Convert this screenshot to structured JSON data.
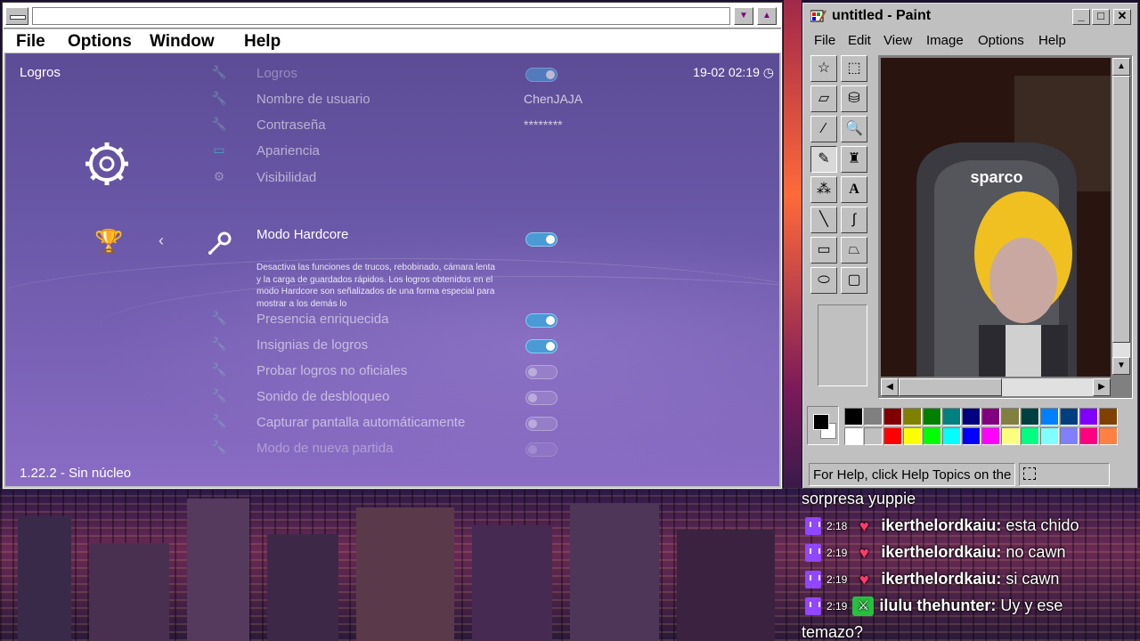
{
  "retroarch": {
    "menu": [
      "File",
      "Options",
      "Window",
      "Help"
    ],
    "header_title": "Logros",
    "clock": "19-02 02:19",
    "version": "1.22.2 - Sin núcleo",
    "rows": [
      {
        "label": "Logros",
        "value": "",
        "toggle": "on",
        "style": "dimmer"
      },
      {
        "label": "Nombre de usuario",
        "value": "ChenJAJA",
        "toggle": "",
        "style": "dim"
      },
      {
        "label": "Contraseña",
        "value": "********",
        "toggle": "",
        "style": "dim"
      },
      {
        "label": "Apariencia",
        "value": "",
        "toggle": "",
        "style": "dim"
      },
      {
        "label": "Visibilidad",
        "value": "",
        "toggle": "",
        "style": "dim"
      }
    ],
    "selected": {
      "label": "Modo Hardcore",
      "description": "Desactiva las funciones de trucos, rebobinado, cámara lenta y la carga de guardados rápidos. Los logros obtenidos en el modo Hardcore son señalizados de una forma especial para mostrar a los demás lo"
    },
    "rows_below": [
      {
        "label": "Presencia enriquecida",
        "toggle": "on"
      },
      {
        "label": "Insignias de logros",
        "toggle": "on"
      },
      {
        "label": "Probar logros no oficiales",
        "toggle": "off"
      },
      {
        "label": "Sonido de desbloqueo",
        "toggle": "off"
      },
      {
        "label": "Capturar pantalla automáticamente",
        "toggle": "off"
      },
      {
        "label": "Modo de nueva partida",
        "toggle": "off"
      }
    ],
    "icons": {
      "settings": "gear-icon",
      "achievements": "trophy-icon",
      "back": "chevron-left-icon",
      "selected": "wrench-icon"
    }
  },
  "paint": {
    "title": "untitled - Paint",
    "menu": [
      "File",
      "Edit",
      "View",
      "Image",
      "Options",
      "Help"
    ],
    "status": "For Help, click Help Topics on the",
    "canvas_text": "sparco",
    "tools": [
      "free-select",
      "select",
      "eraser",
      "fill",
      "eyedropper",
      "magnifier",
      "pencil",
      "brush",
      "airbrush",
      "text",
      "line",
      "curve",
      "rectangle",
      "polygon",
      "ellipse",
      "rounded-rectangle"
    ],
    "palette_row1": [
      "#000000",
      "#808080",
      "#800000",
      "#808000",
      "#008000",
      "#008080",
      "#000080",
      "#800080",
      "#808040",
      "#004040",
      "#0080ff",
      "#004080",
      "#8000ff",
      "#804000"
    ],
    "palette_row2": [
      "#ffffff",
      "#c0c0c0",
      "#ff0000",
      "#ffff00",
      "#00ff00",
      "#00ffff",
      "#0000ff",
      "#ff00ff",
      "#ffff80",
      "#00ff80",
      "#80ffff",
      "#8080ff",
      "#ff0080",
      "#ff8040"
    ]
  },
  "chat": [
    {
      "time": "",
      "badge": "",
      "user": "",
      "message": "sorpresa yuppie"
    },
    {
      "time": "2:18",
      "badge": "heart",
      "user": "ikerthelordkaiu:",
      "message": "esta chido"
    },
    {
      "time": "2:19",
      "badge": "heart",
      "user": "ikerthelordkaiu:",
      "message": "no cawn"
    },
    {
      "time": "2:19",
      "badge": "heart",
      "user": "ikerthelordkaiu:",
      "message": "si cawn"
    },
    {
      "time": "2:19",
      "badge": "sword",
      "user": "ilulu thehunter:",
      "message": "Uy y ese"
    },
    {
      "time": "",
      "badge": "",
      "user": "",
      "message": "temazo?"
    }
  ]
}
